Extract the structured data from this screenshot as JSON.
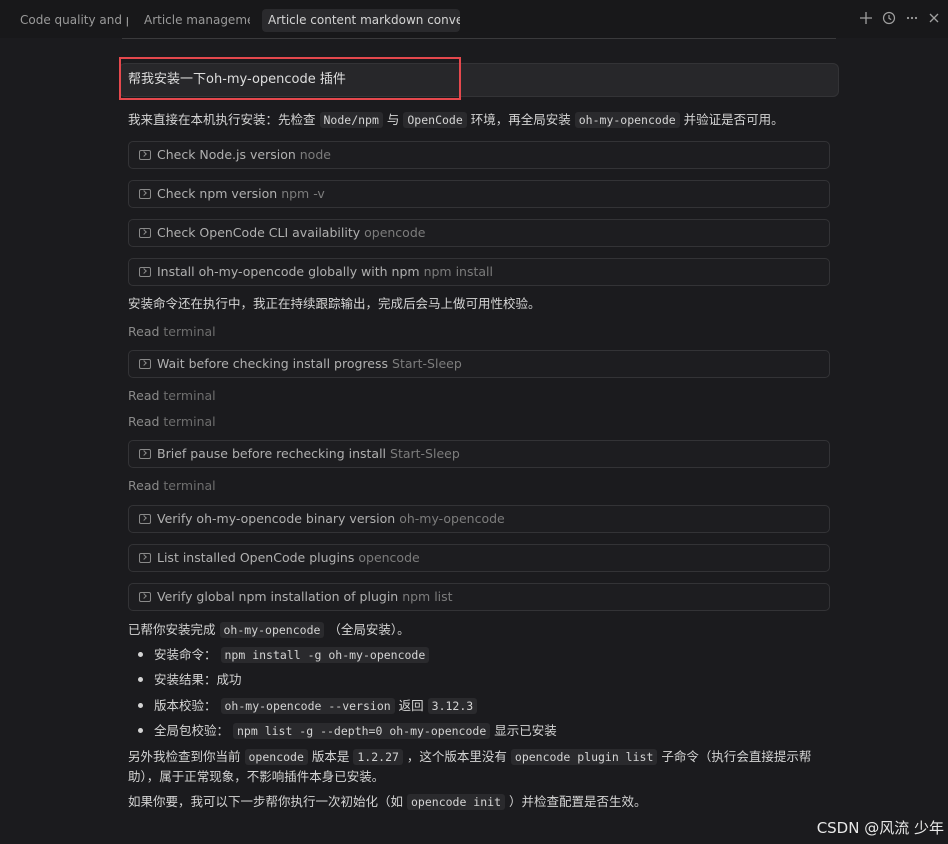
{
  "tabs": [
    {
      "label": "Code quality and pe"
    },
    {
      "label": "Article management"
    },
    {
      "label": "Article content markdown conversi"
    }
  ],
  "toolbar_icons": [
    "plus-icon",
    "history-icon",
    "more-icon",
    "close-icon"
  ],
  "user_message": "帮我安装一下oh-my-opencode 插件",
  "intro": {
    "text_a": "我来直接在本机执行安装：先检查",
    "code_a": "Node/npm",
    "text_b": "与",
    "code_b": "OpenCode",
    "text_c": "环境，再全局安装",
    "code_c": "oh-my-opencode",
    "text_d": "并验证是否可用。"
  },
  "tools": [
    {
      "label": "Check Node.js version",
      "cmd": "node"
    },
    {
      "label": "Check npm version",
      "cmd": "npm -v"
    },
    {
      "label": "Check OpenCode CLI availability",
      "cmd": "opencode"
    },
    {
      "label": "Install oh-my-opencode globally with npm",
      "cmd": "npm install"
    },
    {
      "label": "Wait before checking install progress",
      "cmd": "Start-Sleep"
    },
    {
      "label": "Brief pause before rechecking install",
      "cmd": "Start-Sleep"
    },
    {
      "label": "Verify oh-my-opencode binary version",
      "cmd": "oh-my-opencode"
    },
    {
      "label": "List installed OpenCode plugins",
      "cmd": "opencode"
    },
    {
      "label": "Verify global npm installation of plugin",
      "cmd": "npm list"
    }
  ],
  "progress_text": "安装命令还在执行中，我正在持续跟踪输出，完成后会马上做可用性校验。",
  "read_label": "Read",
  "read_target": "terminal",
  "done": {
    "text_a": "已帮你安装完成",
    "code": "oh-my-opencode",
    "text_b": "（全局安装）。"
  },
  "bullets": [
    {
      "label": "安装命令：",
      "code": "npm install -g oh-my-opencode",
      "suffix": ""
    },
    {
      "label": "安装结果：成功",
      "code": "",
      "suffix": ""
    },
    {
      "label": "版本校验：",
      "code": "oh-my-opencode --version",
      "mid": "返回",
      "code2": "3.12.3"
    },
    {
      "label": "全局包校验：",
      "code": "npm list -g --depth=0 oh-my-opencode",
      "suffix": "显示已安装"
    }
  ],
  "note": {
    "text_a": "另外我检查到你当前",
    "code_a": "opencode",
    "text_b": "版本是",
    "code_b": "1.2.27",
    "text_c": "，这个版本里没有",
    "code_c": "opencode plugin list",
    "text_d": "子命令（执行会直接提示帮",
    "text_e": "助），属于正常现象，不影响插件本身已安装。"
  },
  "followup": {
    "text_a": "如果你要，我可以下一步帮你执行一次初始化（如",
    "code": "opencode init",
    "text_b": "）并检查配置是否生效。"
  },
  "watermark": "CSDN @风流 少年",
  "colors": {
    "highlight": "#e5484d",
    "background": "#1b1b1e"
  }
}
